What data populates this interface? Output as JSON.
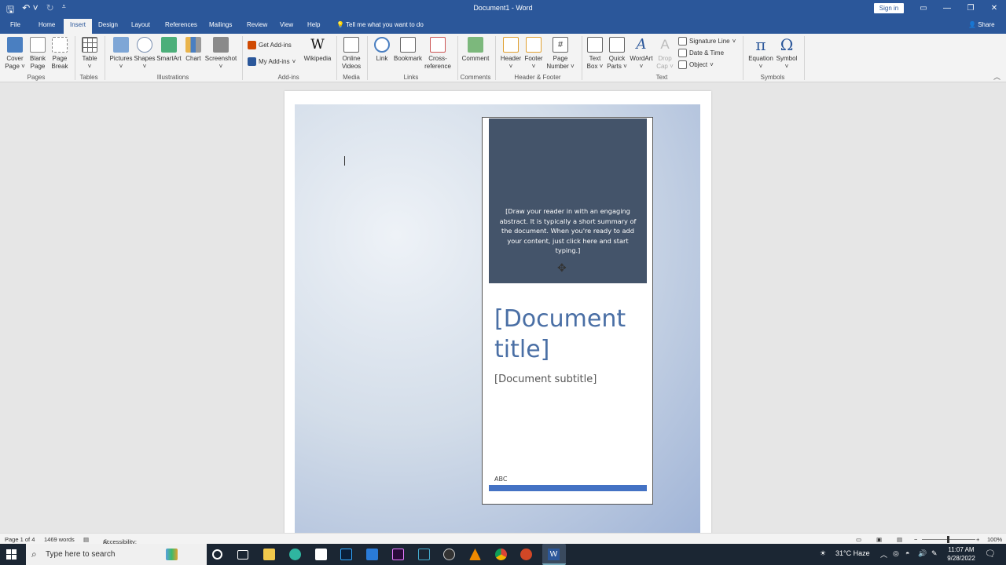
{
  "app": {
    "title": "Document1 - Word",
    "signin": "Sign in",
    "share": "Share"
  },
  "tabs": [
    "File",
    "Home",
    "Insert",
    "Design",
    "Layout",
    "References",
    "Mailings",
    "Review",
    "View",
    "Help"
  ],
  "tellme": "Tell me what you want to do",
  "ribbon": {
    "cover_page_1": "Cover",
    "cover_page_2": "Page ˅",
    "blank_page_1": "Blank",
    "blank_page_2": "Page",
    "page_break_1": "Page",
    "page_break_2": "Break",
    "table": "Table",
    "pictures": "Pictures",
    "shapes": "Shapes",
    "smartart": "SmartArt",
    "chart": "Chart",
    "screenshot": "Screenshot",
    "get_addins": "Get Add-ins",
    "my_addins": "My Add-ins",
    "wikipedia": "Wikipedia",
    "online_videos_1": "Online",
    "online_videos_2": "Videos",
    "link": "Link",
    "bookmark": "Bookmark",
    "cross_ref_1": "Cross-",
    "cross_ref_2": "reference",
    "comment": "Comment",
    "header": "Header",
    "footer": "Footer",
    "page_number_1": "Page",
    "page_number_2": "Number ˅",
    "text_box_1": "Text",
    "text_box_2": "Box ˅",
    "quick_parts_1": "Quick",
    "quick_parts_2": "Parts ˅",
    "wordart": "WordArt",
    "drop_cap_1": "Drop",
    "drop_cap_2": "Cap ˅",
    "signature_line": "Signature Line",
    "date_time": "Date & Time",
    "object": "Object",
    "equation": "Equation",
    "symbol": "Symbol"
  },
  "groups": {
    "pages": "Pages",
    "tables": "Tables",
    "illustrations": "Illustrations",
    "addins": "Add-ins",
    "media": "Media",
    "links": "Links",
    "comments": "Comments",
    "header_footer": "Header & Footer",
    "text": "Text",
    "symbols": "Symbols"
  },
  "document": {
    "abstract": "[Draw your reader in with an engaging abstract. It is typically a short summary of the document. When you're ready to add your content, just click here and start typing.]",
    "title": "[Document title]",
    "subtitle": "[Document subtitle]",
    "abc": "ABC"
  },
  "status": {
    "page": "Page 1 of 4",
    "words": "1469 words",
    "accessibility": "Accessibility: Investigate",
    "zoom": "100%"
  },
  "taskbar": {
    "search": "Type here to search",
    "weather": "31°C  Haze",
    "time": "11:07 AM",
    "date": "9/28/2022"
  },
  "colors": {
    "word_blue": "#2b579a",
    "panel_dark": "#44546a",
    "title_blue": "#4a6fa5",
    "accent_bar": "#4472c4"
  }
}
